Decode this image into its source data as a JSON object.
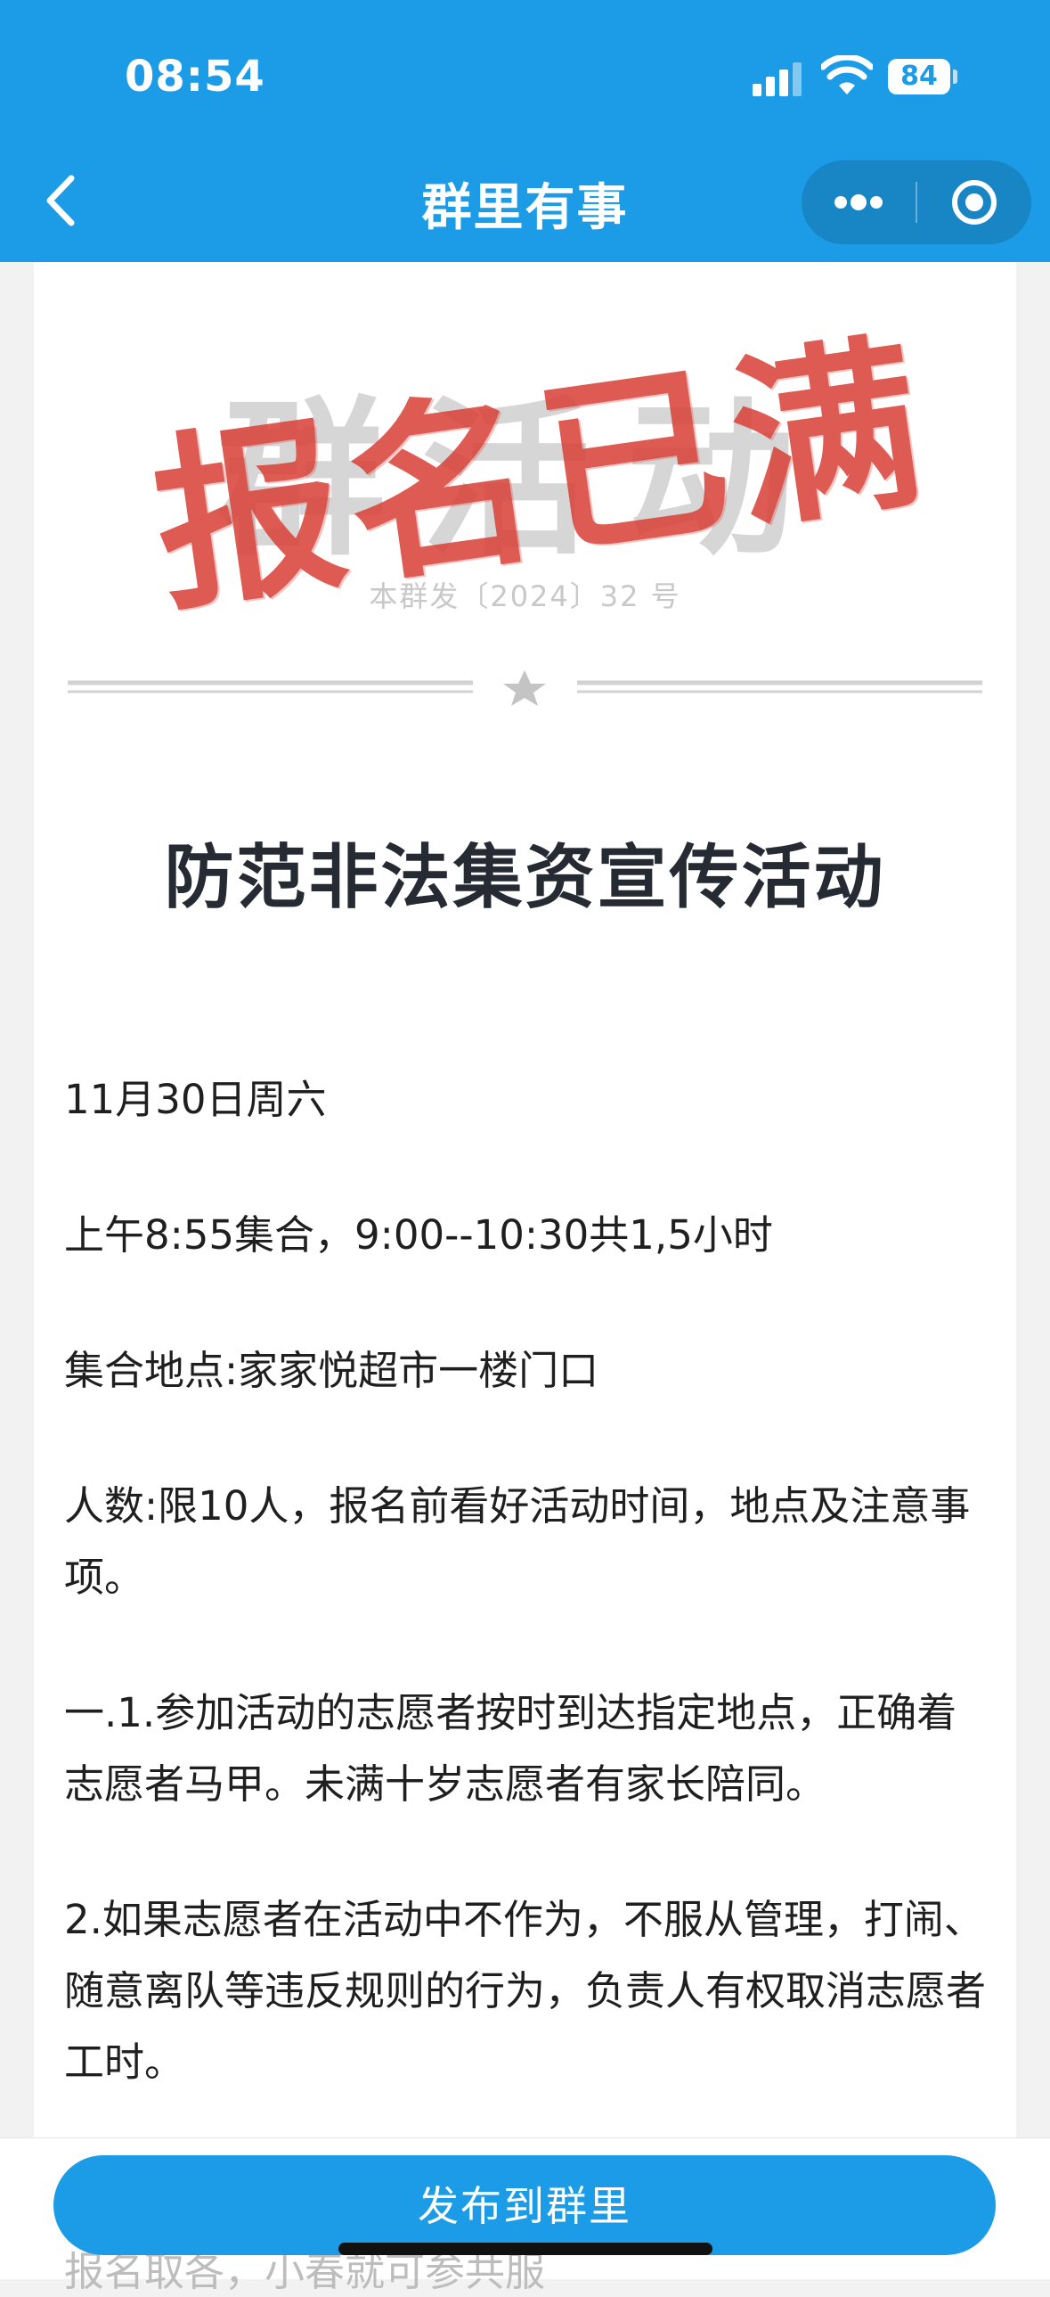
{
  "status_bar": {
    "time": "08:54",
    "battery": "84"
  },
  "nav": {
    "title": "群里有事",
    "back_icon": "chevron-left-icon",
    "more_icon": "more-dots-icon",
    "close_icon": "target-close-icon"
  },
  "header": {
    "watermark_title": "群活动",
    "stamp_text": "报名已满",
    "doc_number": "本群发〔2024〕32 号",
    "stamp_color": "#d9453c"
  },
  "document": {
    "title": "防范非法集资宣传活动",
    "paragraphs": [
      "11月30日周六",
      "上午8:55集合，9:00--10:30共1,5小时",
      "集合地点:家家悦超市一楼门口",
      "人数:限10人，报名前看好活动时间，地点及注意事项。",
      "一.1.参加活动的志愿者按时到达指定地点，正确着志愿者马甲。未满十岁志愿者有家长陪同。",
      "2.如果志愿者在活动中不作为，不服从管理，打闹、随意离队等违反规则的行为，负责人有权取消志愿者工时。"
    ],
    "peek_text": "报名取各，小春就可参共服"
  },
  "actions": {
    "publish_label": "发布到群里"
  },
  "colors": {
    "primary": "#1c9be6",
    "background": "#f2f2f2"
  }
}
